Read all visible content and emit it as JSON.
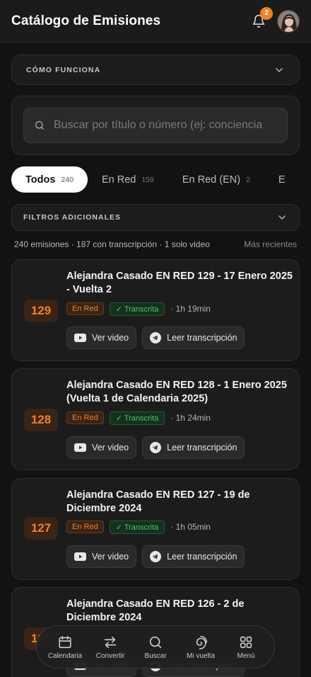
{
  "header": {
    "title": "Catálogo de Emisiones",
    "notification_count": "2",
    "bell_icon": "bell-icon",
    "avatar": "user-avatar"
  },
  "how_it_works": {
    "label": "CÓMO FUNCIONA",
    "icon": "chevron-down-icon"
  },
  "search": {
    "placeholder": "Buscar por título o número (ej: conciencia",
    "value": "",
    "icon": "search-icon"
  },
  "tabs": [
    {
      "label": "Todos",
      "count": "240",
      "active": true
    },
    {
      "label": "En Red",
      "count": "159"
    },
    {
      "label": "En Red (EN)",
      "count": "2"
    },
    {
      "label": "E",
      "count": ""
    }
  ],
  "filters": {
    "label": "FILTROS ADICIONALES",
    "icon": "chevron-down-icon"
  },
  "summary": {
    "text": "240 emisiones · 187 con transcripción · 1 solo video",
    "sort": "Más recientes"
  },
  "episodes": [
    {
      "number": "129",
      "title": "Alejandra Casado EN RED 129 - 17 Enero 2025 - Vuelta 2",
      "tag": "En Red",
      "transcribed": "✓ Transcrita",
      "duration": "· 1h 19min",
      "video_label": "Ver video",
      "transcript_label": "Leer transcripción"
    },
    {
      "number": "128",
      "title": "Alejandra Casado EN RED 128 - 1 Enero 2025 (Vuelta 1 de Calendaria 2025)",
      "tag": "En Red",
      "transcribed": "✓ Transcrita",
      "duration": "· 1h 24min",
      "video_label": "Ver video",
      "transcript_label": "Leer transcripción"
    },
    {
      "number": "127",
      "title": "Alejandra Casado EN RED 127 - 19 de Diciembre 2024",
      "tag": "En Red",
      "transcribed": "✓ Transcrita",
      "duration": "· 1h 05min",
      "video_label": "Ver video",
      "transcript_label": "Leer transcripción"
    },
    {
      "number": "126",
      "title": "Alejandra Casado EN RED 126 - 2 de Diciembre 2024",
      "video_label": "Ver video",
      "transcript_label": "Leer transcripción"
    }
  ],
  "nav": [
    {
      "label": "Calendaria",
      "icon": "calendar-icon"
    },
    {
      "label": "Convertir",
      "icon": "swap-arrows-icon"
    },
    {
      "label": "Buscar",
      "icon": "search-icon"
    },
    {
      "label": "Mi vuelta",
      "icon": "spiral-icon"
    },
    {
      "label": "Menú",
      "icon": "grid-icon"
    }
  ],
  "colors": {
    "accent": "#f0821e",
    "success": "#4cc46a",
    "background": "#121212",
    "card": "#1c1c1c"
  }
}
